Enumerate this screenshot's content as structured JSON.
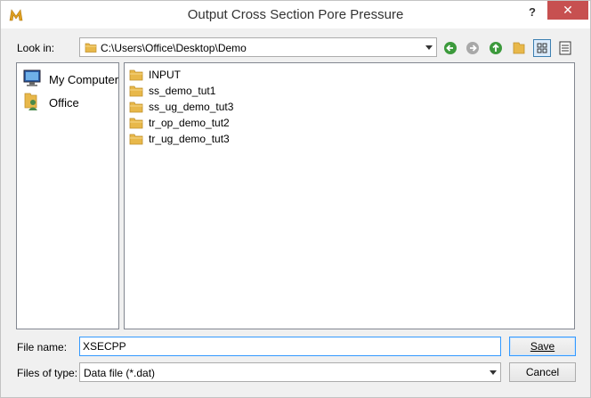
{
  "window": {
    "title": "Output Cross Section Pore Pressure",
    "help_label": "?",
    "close_label": "✕",
    "app_icon": "app-logo-icon"
  },
  "lookin": {
    "label": "Look in:",
    "path": "C:\\Users\\Office\\Desktop\\Demo"
  },
  "toolbar": {
    "icons": [
      "back-icon",
      "forward-icon",
      "up-folder-icon",
      "new-folder-icon",
      "list-view-icon",
      "detail-view-icon"
    ]
  },
  "sidebar": {
    "items": [
      {
        "label": "My Computer",
        "icon": "computer-icon"
      },
      {
        "label": "Office",
        "icon": "user-icon"
      }
    ]
  },
  "files": [
    {
      "name": "INPUT"
    },
    {
      "name": "ss_demo_tut1"
    },
    {
      "name": "ss_ug_demo_tut3"
    },
    {
      "name": "tr_op_demo_tut2"
    },
    {
      "name": "tr_ug_demo_tut3"
    }
  ],
  "filename": {
    "label": "File name:",
    "value": "XSECPP"
  },
  "filetype": {
    "label": "Files of type:",
    "value": "Data file (*.dat)"
  },
  "buttons": {
    "save": "Save",
    "cancel": "Cancel"
  },
  "colors": {
    "close_button": "#c75050",
    "folder": "#e8b84a",
    "focus_border": "#3399ff"
  }
}
